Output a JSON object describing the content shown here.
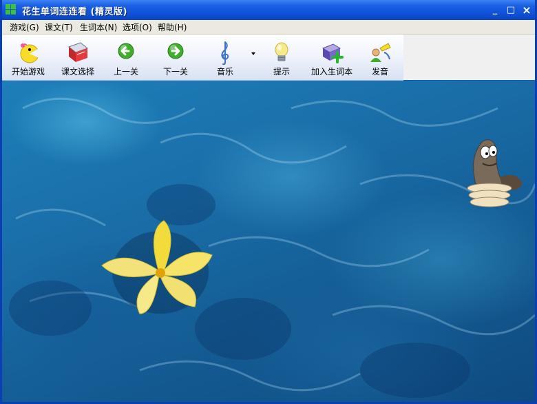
{
  "window": {
    "title": "花生单词连连看 (精灵版)",
    "controls": {
      "minimize": "_",
      "maximize": "□",
      "close": "×"
    }
  },
  "menu": {
    "items": [
      {
        "label": "游戏(G)"
      },
      {
        "label": "课文(T)"
      },
      {
        "label": "生词本(N)"
      },
      {
        "label": "选项(O)"
      },
      {
        "label": "帮助(H)"
      }
    ]
  },
  "toolbar": {
    "buttons": [
      {
        "label": "开始游戏",
        "icon": "pacman-icon"
      },
      {
        "label": "课文选择",
        "icon": "book-icon"
      },
      {
        "label": "上一关",
        "icon": "arrow-left-icon"
      },
      {
        "label": "下一关",
        "icon": "arrow-right-icon"
      },
      {
        "label": "音乐",
        "icon": "treble-clef-icon"
      },
      {
        "label": "提示",
        "icon": "lightbulb-icon"
      },
      {
        "label": "加入生词本",
        "icon": "book-plus-icon"
      },
      {
        "label": "发音",
        "icon": "speaker-person-icon"
      }
    ]
  },
  "colors": {
    "titlebar": "#0f50d6",
    "water": "#1a6ea8",
    "flower": "#f5e04a"
  }
}
